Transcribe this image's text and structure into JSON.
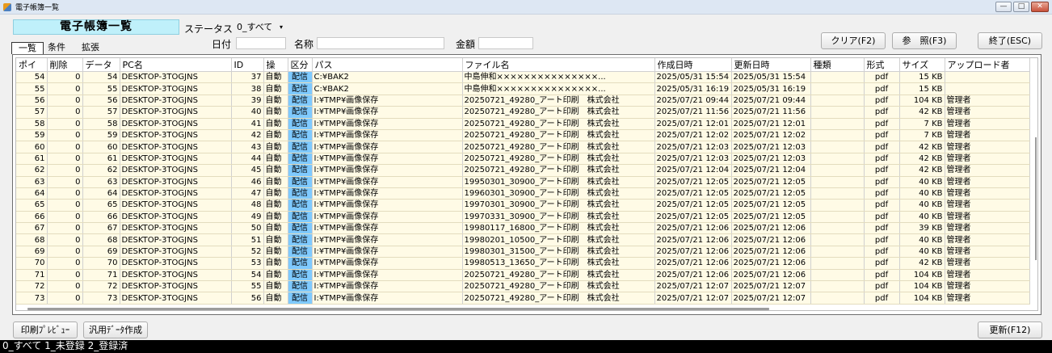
{
  "window": {
    "title": "電子帳簿一覧",
    "min_glyph": "—",
    "max_glyph": "□",
    "close_glyph": "✕"
  },
  "header": {
    "page_title": "電子帳簿一覧",
    "status_label": "ステータス",
    "status_value": "0_すべて",
    "date_label": "日付",
    "name_label": "名称",
    "amount_label": "金額"
  },
  "toolbar": {
    "clear_label": "クリア(F2)",
    "browse_label": "参　照(F3)",
    "exit_label": "終了(ESC)"
  },
  "tabs": [
    {
      "label": "一覧",
      "active": true
    },
    {
      "label": "条件",
      "active": false
    },
    {
      "label": "拡張",
      "active": false
    }
  ],
  "table": {
    "columns": [
      "ポイ",
      "削除",
      "データ",
      "PC名",
      "ID",
      "操",
      "区分",
      "パス",
      "ファイル名",
      "作成日時",
      "更新日時",
      "種類",
      "形式",
      "サイズ",
      "アップロード者"
    ],
    "rows": [
      [
        "54",
        "0",
        "54",
        "DESKTOP-3TOGJNS",
        "37",
        "自動",
        "配信",
        "C:¥BAK2",
        "中島伸和×××××××××××××××...",
        "2025/05/31 15:54",
        "2025/05/31 15:54",
        "",
        "pdf",
        "15 KB",
        ""
      ],
      [
        "55",
        "0",
        "55",
        "DESKTOP-3TOGJNS",
        "38",
        "自動",
        "配信",
        "C:¥BAK2",
        "中島伸和×××××××××××××××...",
        "2025/05/31 16:19",
        "2025/05/31 16:19",
        "",
        "pdf",
        "15 KB",
        ""
      ],
      [
        "56",
        "0",
        "56",
        "DESKTOP-3TOGJNS",
        "39",
        "自動",
        "配信",
        "I:¥TMP¥画像保存",
        "20250721_49280_アート印刷　株式会社",
        "2025/07/21 09:44",
        "2025/07/21 09:44",
        "",
        "pdf",
        "104 KB",
        "管理者"
      ],
      [
        "57",
        "0",
        "57",
        "DESKTOP-3TOGJNS",
        "40",
        "自動",
        "配信",
        "I:¥TMP¥画像保存",
        "20250721_49280_アート印刷　株式会社",
        "2025/07/21 11:56",
        "2025/07/21 11:56",
        "",
        "pdf",
        "42 KB",
        "管理者"
      ],
      [
        "58",
        "0",
        "58",
        "DESKTOP-3TOGJNS",
        "41",
        "自動",
        "配信",
        "I:¥TMP¥画像保存",
        "20250721_49280_アート印刷　株式会社",
        "2025/07/21 12:01",
        "2025/07/21 12:01",
        "",
        "pdf",
        "7 KB",
        "管理者"
      ],
      [
        "59",
        "0",
        "59",
        "DESKTOP-3TOGJNS",
        "42",
        "自動",
        "配信",
        "I:¥TMP¥画像保存",
        "20250721_49280_アート印刷　株式会社",
        "2025/07/21 12:02",
        "2025/07/21 12:02",
        "",
        "pdf",
        "7 KB",
        "管理者"
      ],
      [
        "60",
        "0",
        "60",
        "DESKTOP-3TOGJNS",
        "43",
        "自動",
        "配信",
        "I:¥TMP¥画像保存",
        "20250721_49280_アート印刷　株式会社",
        "2025/07/21 12:03",
        "2025/07/21 12:03",
        "",
        "pdf",
        "42 KB",
        "管理者"
      ],
      [
        "61",
        "0",
        "61",
        "DESKTOP-3TOGJNS",
        "44",
        "自動",
        "配信",
        "I:¥TMP¥画像保存",
        "20250721_49280_アート印刷　株式会社",
        "2025/07/21 12:03",
        "2025/07/21 12:03",
        "",
        "pdf",
        "42 KB",
        "管理者"
      ],
      [
        "62",
        "0",
        "62",
        "DESKTOP-3TOGJNS",
        "45",
        "自動",
        "配信",
        "I:¥TMP¥画像保存",
        "20250721_49280_アート印刷　株式会社",
        "2025/07/21 12:04",
        "2025/07/21 12:04",
        "",
        "pdf",
        "42 KB",
        "管理者"
      ],
      [
        "63",
        "0",
        "63",
        "DESKTOP-3TOGJNS",
        "46",
        "自動",
        "配信",
        "I:¥TMP¥画像保存",
        "19950301_30900_アート印刷　株式会社",
        "2025/07/21 12:05",
        "2025/07/21 12:05",
        "",
        "pdf",
        "40 KB",
        "管理者"
      ],
      [
        "64",
        "0",
        "64",
        "DESKTOP-3TOGJNS",
        "47",
        "自動",
        "配信",
        "I:¥TMP¥画像保存",
        "19960301_30900_アート印刷　株式会社",
        "2025/07/21 12:05",
        "2025/07/21 12:05",
        "",
        "pdf",
        "40 KB",
        "管理者"
      ],
      [
        "65",
        "0",
        "65",
        "DESKTOP-3TOGJNS",
        "48",
        "自動",
        "配信",
        "I:¥TMP¥画像保存",
        "19970301_30900_アート印刷　株式会社",
        "2025/07/21 12:05",
        "2025/07/21 12:05",
        "",
        "pdf",
        "40 KB",
        "管理者"
      ],
      [
        "66",
        "0",
        "66",
        "DESKTOP-3TOGJNS",
        "49",
        "自動",
        "配信",
        "I:¥TMP¥画像保存",
        "19970331_30900_アート印刷　株式会社",
        "2025/07/21 12:05",
        "2025/07/21 12:05",
        "",
        "pdf",
        "40 KB",
        "管理者"
      ],
      [
        "67",
        "0",
        "67",
        "DESKTOP-3TOGJNS",
        "50",
        "自動",
        "配信",
        "I:¥TMP¥画像保存",
        "19980117_16800_アート印刷　株式会社",
        "2025/07/21 12:06",
        "2025/07/21 12:06",
        "",
        "pdf",
        "39 KB",
        "管理者"
      ],
      [
        "68",
        "0",
        "68",
        "DESKTOP-3TOGJNS",
        "51",
        "自動",
        "配信",
        "I:¥TMP¥画像保存",
        "19980201_10500_アート印刷　株式会社",
        "2025/07/21 12:06",
        "2025/07/21 12:06",
        "",
        "pdf",
        "40 KB",
        "管理者"
      ],
      [
        "69",
        "0",
        "69",
        "DESKTOP-3TOGJNS",
        "52",
        "自動",
        "配信",
        "I:¥TMP¥画像保存",
        "19980301_31500_アート印刷　株式会社",
        "2025/07/21 12:06",
        "2025/07/21 12:06",
        "",
        "pdf",
        "40 KB",
        "管理者"
      ],
      [
        "70",
        "0",
        "70",
        "DESKTOP-3TOGJNS",
        "53",
        "自動",
        "配信",
        "I:¥TMP¥画像保存",
        "19980513_13650_アート印刷　株式会社",
        "2025/07/21 12:06",
        "2025/07/21 12:06",
        "",
        "pdf",
        "42 KB",
        "管理者"
      ],
      [
        "71",
        "0",
        "71",
        "DESKTOP-3TOGJNS",
        "54",
        "自動",
        "配信",
        "I:¥TMP¥画像保存",
        "20250721_49280_アート印刷　株式会社",
        "2025/07/21 12:06",
        "2025/07/21 12:06",
        "",
        "pdf",
        "104 KB",
        "管理者"
      ],
      [
        "72",
        "0",
        "72",
        "DESKTOP-3TOGJNS",
        "55",
        "自動",
        "配信",
        "I:¥TMP¥画像保存",
        "20250721_49280_アート印刷　株式会社",
        "2025/07/21 12:07",
        "2025/07/21 12:07",
        "",
        "pdf",
        "104 KB",
        "管理者"
      ],
      [
        "73",
        "0",
        "73",
        "DESKTOP-3TOGJNS",
        "56",
        "自動",
        "配信",
        "I:¥TMP¥画像保存",
        "20250721_49280_アート印刷　株式会社",
        "2025/07/21 12:07",
        "2025/07/21 12:07",
        "",
        "pdf",
        "104 KB",
        "管理者"
      ]
    ]
  },
  "footer": {
    "print_preview_label": "印刷ﾌﾟﾚﾋﾞｭｰ",
    "export_label": "汎用ﾃﾞｰﾀ作成",
    "refresh_label": "更新(F12)"
  },
  "statusbar": {
    "text": "0_すべて 1_未登録 2_登録済"
  },
  "colors": {
    "row_bg": "#fffbe6",
    "kubun_bg": "#7fcaff",
    "title_box_bg": "#bff0fa"
  }
}
